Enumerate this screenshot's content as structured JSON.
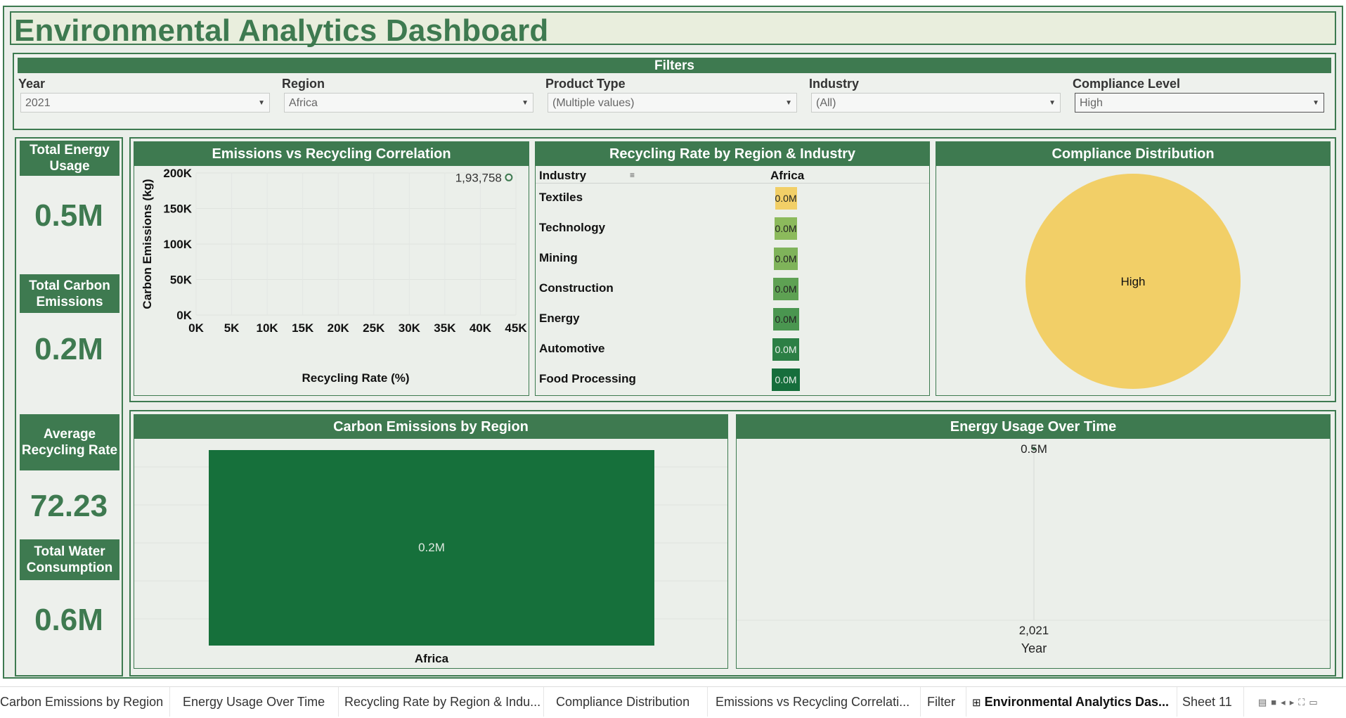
{
  "title": "Environmental Analytics Dashboard",
  "filters": {
    "heading": "Filters",
    "items": [
      {
        "label": "Year",
        "value": "2021"
      },
      {
        "label": "Region",
        "value": "Africa"
      },
      {
        "label": "Product Type",
        "value": "(Multiple values)"
      },
      {
        "label": "Industry",
        "value": "(All)"
      },
      {
        "label": "Compliance Level",
        "value": "High"
      }
    ]
  },
  "kpis": [
    {
      "label": "Total Energy Usage",
      "value": "0.5M"
    },
    {
      "label": "Total Carbon Emissions",
      "value": "0.2M"
    },
    {
      "label": "Average Recycling Rate",
      "value": "72.23"
    },
    {
      "label": "Total Water Consumption",
      "value": "0.6M"
    }
  ],
  "scatter": {
    "title": "Emissions vs Recycling Correlation",
    "xlabel": "Recycling Rate (%)",
    "ylabel": "Carbon Emissions (kg)",
    "xticks": [
      "0K",
      "5K",
      "10K",
      "15K",
      "20K",
      "25K",
      "30K",
      "35K",
      "40K",
      "45K"
    ],
    "yticks": [
      "200K",
      "150K",
      "100K",
      "50K",
      "0K"
    ],
    "point_label": "1,93,758"
  },
  "heatmap": {
    "title": "Recycling Rate by Region & Industry",
    "row_header": "Industry",
    "column": "Africa",
    "rows": [
      {
        "industry": "Textiles",
        "label": "0.0M",
        "color": "#f2cf67"
      },
      {
        "industry": "Technology",
        "label": "0.0M",
        "color": "#8cba5c"
      },
      {
        "industry": "Mining",
        "label": "0.0M",
        "color": "#7fb35a"
      },
      {
        "industry": "Construction",
        "label": "0.0M",
        "color": "#5ea153"
      },
      {
        "industry": "Energy",
        "label": "0.0M",
        "color": "#4a9650"
      },
      {
        "industry": "Automotive",
        "label": "0.0M",
        "color": "#2c7f45"
      },
      {
        "industry": "Food Processing",
        "label": "0.0M",
        "color": "#166e3c"
      }
    ]
  },
  "pie": {
    "title": "Compliance Distribution",
    "slice_label": "High",
    "color": "#f2cf67"
  },
  "bar": {
    "title": "Carbon Emissions by Region",
    "category": "Africa",
    "value_label": "0.2M",
    "color": "#16703b"
  },
  "line": {
    "title": "Energy Usage Over Time",
    "point_label": "0.5M",
    "x_tick": "2,021",
    "xlabel": "Year"
  },
  "chart_data": [
    {
      "type": "scatter",
      "title": "Emissions vs Recycling Correlation",
      "xlabel": "Recycling Rate (%)",
      "ylabel": "Carbon Emissions (kg)",
      "xlim": [
        0,
        45000
      ],
      "ylim": [
        0,
        200000
      ],
      "x": [
        44000
      ],
      "y": [
        193758
      ]
    },
    {
      "type": "heatmap",
      "title": "Recycling Rate by Region & Industry",
      "columns": [
        "Africa"
      ],
      "rows": [
        "Textiles",
        "Technology",
        "Mining",
        "Construction",
        "Energy",
        "Automotive",
        "Food Processing"
      ],
      "values": [
        [
          0.0
        ],
        [
          0.0
        ],
        [
          0.0
        ],
        [
          0.0
        ],
        [
          0.0
        ],
        [
          0.0
        ],
        [
          0.0
        ]
      ]
    },
    {
      "type": "pie",
      "title": "Compliance Distribution",
      "categories": [
        "High"
      ],
      "values": [
        1
      ]
    },
    {
      "type": "bar",
      "title": "Carbon Emissions by Region",
      "categories": [
        "Africa"
      ],
      "values": [
        0.2
      ]
    },
    {
      "type": "line",
      "title": "Energy Usage Over Time",
      "xlabel": "Year",
      "x": [
        2021
      ],
      "values": [
        0.5
      ]
    }
  ],
  "tabs": [
    "Carbon Emissions by Region",
    "Energy Usage Over Time",
    "Recycling Rate by Region & Indu...",
    "Compliance Distribution",
    "Emissions vs Recycling Correlati...",
    "Filter",
    "Environmental Analytics Das...",
    "Sheet 11"
  ]
}
